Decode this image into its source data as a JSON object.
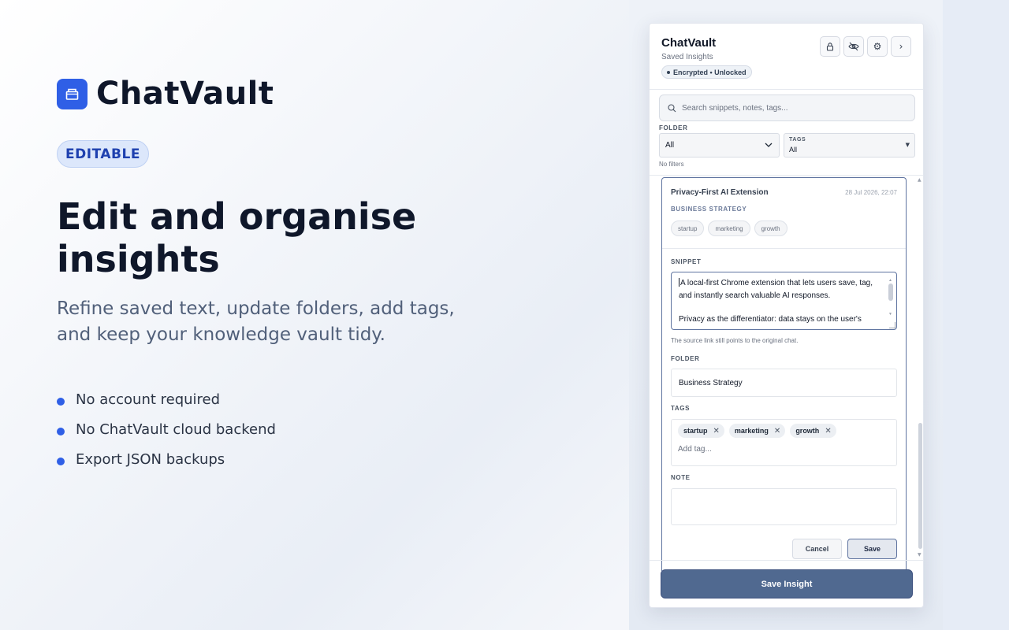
{
  "hero": {
    "brand": "ChatVault",
    "badge": "EDITABLE",
    "headline": "Edit and organise insights",
    "subhead": "Refine saved text, update folders, add tags, and keep your knowledge vault tidy.",
    "bullets": [
      "No account required",
      "No ChatVault cloud backend",
      "Export JSON backups"
    ]
  },
  "panel": {
    "title": "ChatVault",
    "subtitle": "Saved Insights",
    "status": "Encrypted • Unlocked",
    "icons": [
      "lock-icon",
      "eye-off-icon",
      "gear-icon",
      "chevron-right-icon"
    ],
    "search": {
      "placeholder": "Search snippets, notes, tags..."
    },
    "filters": {
      "folder_label": "FOLDER",
      "folder_value": "All",
      "tags_label": "TAGS",
      "tags_value": "All",
      "summary": "No filters"
    },
    "card": {
      "title": "Privacy-First AI Extension",
      "date": "28 Jul 2026, 22:07",
      "folder": "BUSINESS STRATEGY",
      "tags": [
        "startup",
        "marketing",
        "growth"
      ]
    },
    "editor": {
      "snippet_label": "SNIPPET",
      "snippet_line1": "A local-first Chrome extension that lets users save, tag,",
      "snippet_line2": "and instantly search valuable AI responses.",
      "snippet_line3": "Privacy as the differentiator: data stays on the user's",
      "hint": "The source link still points to the original chat.",
      "folder_label": "FOLDER",
      "folder_value": "Business Strategy",
      "tags_label": "TAGS",
      "tags": [
        "startup",
        "marketing",
        "growth"
      ],
      "tag_placeholder": "Add tag...",
      "note_label": "NOTE",
      "note_value": "",
      "cancel_label": "Cancel",
      "save_label": "Save"
    },
    "primary_button": "Save Insight"
  },
  "colors": {
    "accent": "#2f5fe6",
    "primary_button": "#506990",
    "badge_bg": "#dce7fb",
    "badge_text": "#1e40af"
  }
}
